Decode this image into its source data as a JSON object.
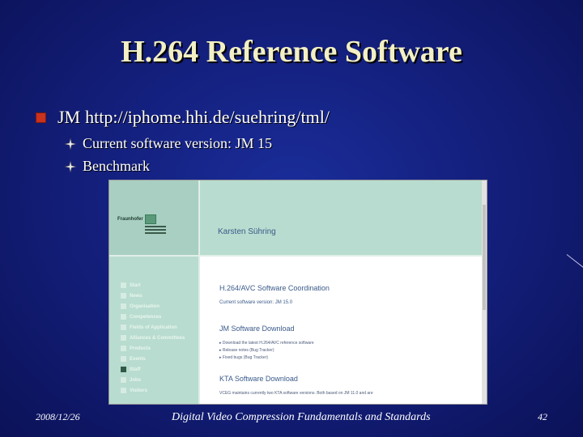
{
  "slide": {
    "title": "H.264 Reference Software",
    "bullet_jm_label": "JM",
    "bullet_jm_url": "http://iphome.hhi.de/suehring/tml/",
    "sub_bullets": [
      "Current software version: JM 15",
      "Benchmark"
    ]
  },
  "screenshot": {
    "logo_word": "Fraunhofer",
    "person_name": "Karsten Sühring",
    "nav_items": [
      "Start",
      "News",
      "Organisation",
      "Competences",
      "Fields of Application",
      "Alliances & Committees",
      "Products",
      "Events",
      "Staff",
      "Jobs",
      "Visitors"
    ],
    "active_nav": "Staff",
    "heading_coordination": "H.264/AVC Software Coordination",
    "current_version": "Current software version: JM 15.0",
    "heading_jm_download": "JM Software Download",
    "jm_links": [
      "Download the latest H.264/AVC reference software",
      "Release notes (Bug Tracker)",
      "Fixed bugs (Bug Tracker)"
    ],
    "heading_kta_download": "KTA Software Download",
    "kta_note": "VCEG maintains currently two KTA software versions. Both based on JM 11.0 and are"
  },
  "footer": {
    "date": "2008/12/26",
    "course": "Digital Video Compression Fundamentals and Standards",
    "page_number": "42"
  },
  "colors": {
    "title_text": "#f2f0c4",
    "bullet_square": "#c8321e",
    "background": "#14207e"
  }
}
